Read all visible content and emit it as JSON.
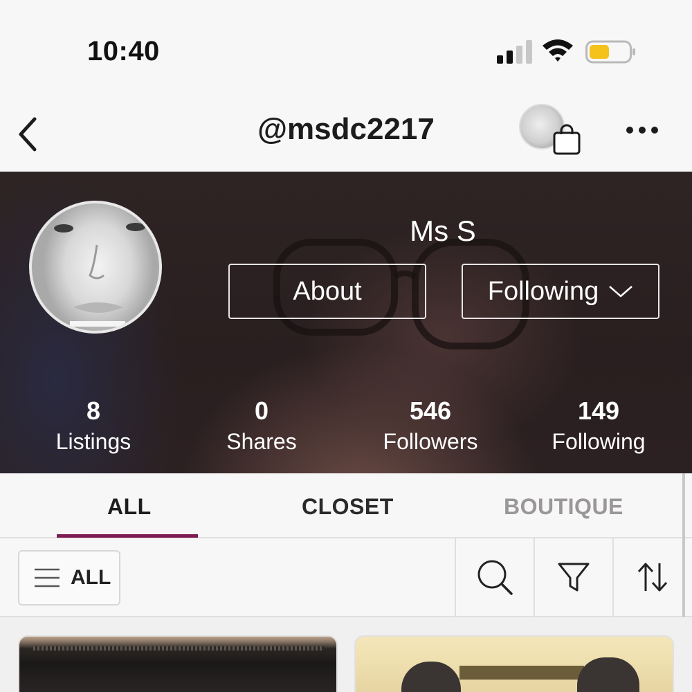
{
  "status_bar": {
    "time": "10:40",
    "signal_icon": "cellular-signal-icon",
    "wifi_icon": "wifi-icon",
    "battery_icon": "battery-icon",
    "battery_color": "#f4c21b"
  },
  "header": {
    "back_icon": "chevron-left-icon",
    "handle": "@msdc2217",
    "shop_icon": "shopping-bag-icon",
    "more_icon": "more-horizontal-icon"
  },
  "profile": {
    "display_name": "Ms S",
    "about_label": "About",
    "following_label": "Following",
    "stats": [
      {
        "value": "8",
        "label": "Listings"
      },
      {
        "value": "0",
        "label": "Shares"
      },
      {
        "value": "546",
        "label": "Followers"
      },
      {
        "value": "149",
        "label": "Following"
      }
    ]
  },
  "tabs": [
    {
      "label": "ALL",
      "active": true
    },
    {
      "label": "CLOSET",
      "active": false
    },
    {
      "label": "BOUTIQUE",
      "active": false
    }
  ],
  "toolbar": {
    "category_label": "ALL",
    "category_icon": "menu-lines-icon",
    "search_icon": "search-icon",
    "filter_icon": "filter-funnel-icon",
    "sort_icon": "sort-arrows-icon"
  },
  "colors": {
    "accent": "#7b1c52",
    "inactive_tab": "#9a9797"
  }
}
